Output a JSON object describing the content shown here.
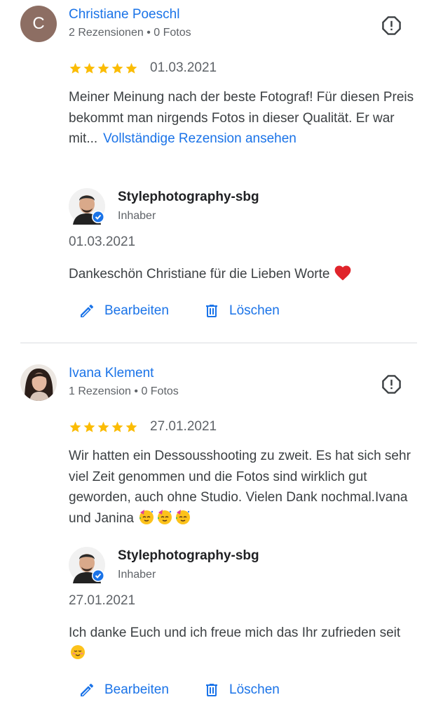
{
  "colors": {
    "link": "#1a73e8",
    "star": "#fbbc04",
    "text": "#3c4043",
    "muted": "#5f6368",
    "verified": "#1a73e8",
    "avatar_letter_bg": "#8d6e63"
  },
  "reviews": [
    {
      "avatar_letter": "C",
      "name": "Christiane Poeschl",
      "meta": "2 Rezensionen • 0 Fotos",
      "rating": 5,
      "date": "01.03.2021",
      "text": "Meiner Meinung nach der beste Fotograf! Für diesen Preis bekommt man nirgends Fotos in dieser Qualität. Er war mit...",
      "more_label": "Vollständige Rezension ansehen",
      "reply": {
        "owner_name": "Stylephotography-sbg",
        "owner_role": "Inhaber",
        "date": "01.03.2021",
        "text": "Dankeschön Christiane für die Lieben Worte",
        "emoji": "heart"
      },
      "actions": {
        "edit_label": "Bearbeiten",
        "delete_label": "Löschen"
      }
    },
    {
      "name": "Ivana Klement",
      "meta": "1 Rezension • 0 Fotos",
      "rating": 5,
      "date": "27.01.2021",
      "text": "Wir hatten ein Dessousshooting zu zweit. Es hat sich sehr viel Zeit genommen und die Fotos sind wirklich gut geworden, auch ohne Studio. Vielen Dank nochmal.Ivana und Janina",
      "emoji": "partying-face x3",
      "reply": {
        "owner_name": "Stylephotography-sbg",
        "owner_role": "Inhaber",
        "date": "27.01.2021",
        "text": "Ich danke Euch und ich freue mich das Ihr zufrieden seit",
        "emoji": "smiling-face"
      },
      "actions": {
        "edit_label": "Bearbeiten",
        "delete_label": "Löschen"
      }
    }
  ]
}
